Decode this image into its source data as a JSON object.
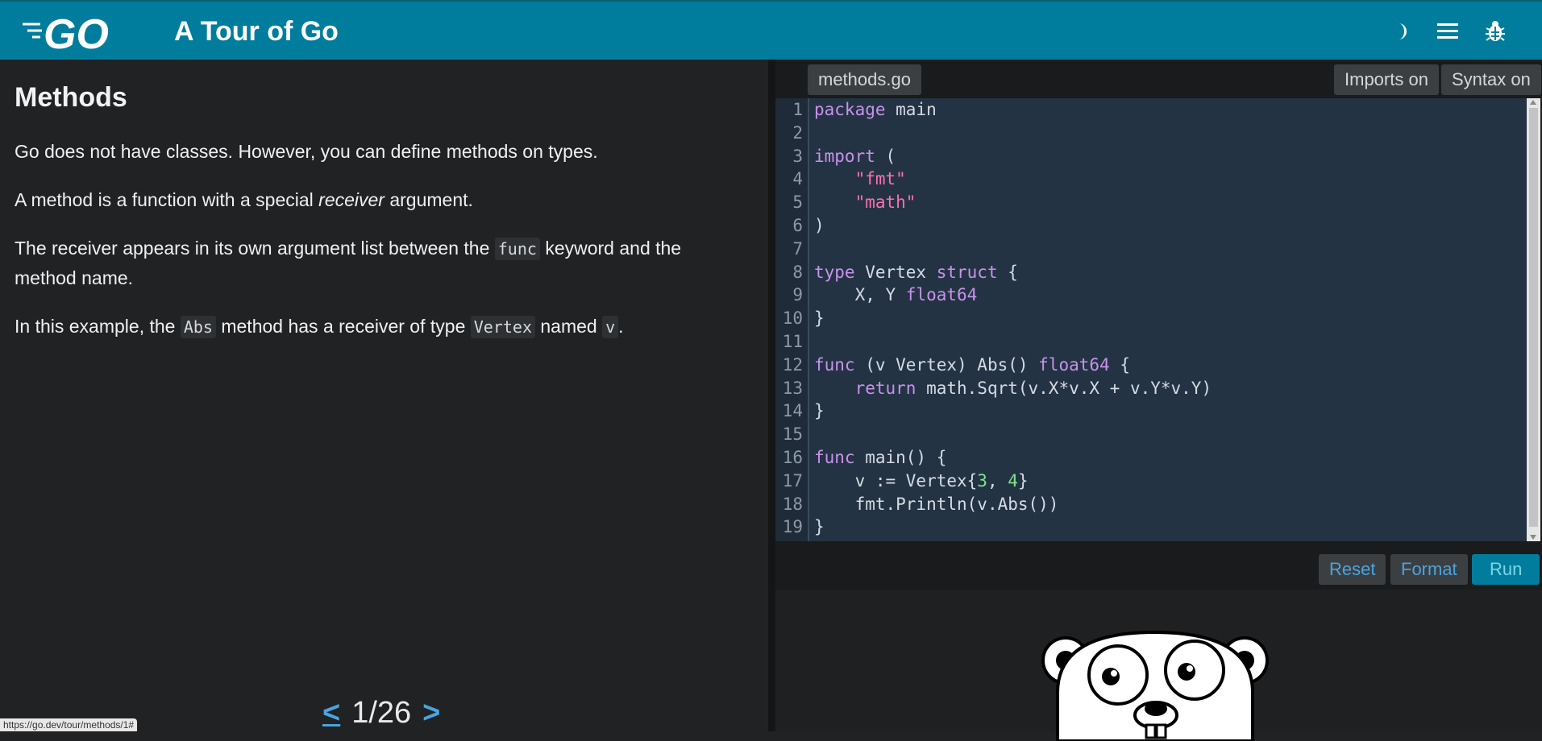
{
  "header": {
    "logo_text": "GO",
    "title": "A Tour of Go",
    "icons": [
      "moon-icon",
      "menu-icon",
      "bug-icon"
    ],
    "bg_color": "#007d9c"
  },
  "lesson": {
    "title": "Methods",
    "p1": "Go does not have classes. However, you can define methods on types.",
    "p2_before": "A method is a function with a special ",
    "p2_em": "receiver",
    "p2_after": " argument.",
    "p3_before": "The receiver appears in its own argument list between the ",
    "p3_code": "func",
    "p3_after": " keyword and the method name.",
    "p4_a": "In this example, the ",
    "p4_code1": "Abs",
    "p4_b": " method has a receiver of type ",
    "p4_code2": "Vertex",
    "p4_c": " named ",
    "p4_code3": "v",
    "p4_d": "."
  },
  "pager": {
    "prev": "<",
    "count": "1/26",
    "next": ">"
  },
  "status_url": "https://go.dev/tour/methods/1#",
  "editor": {
    "filename": "methods.go",
    "imports_label": "Imports on",
    "syntax_label": "Syntax on",
    "line_numbers": [
      "1",
      "2",
      "3",
      "4",
      "5",
      "6",
      "7",
      "8",
      "9",
      "10",
      "11",
      "12",
      "13",
      "14",
      "15",
      "16",
      "17",
      "18",
      "19"
    ],
    "code": {
      "l1_kw": "package",
      "l1_rest": " main",
      "l3_kw": "import",
      "l3_rest": " (",
      "l4": "\"fmt\"",
      "l5": "\"math\"",
      "l6": ")",
      "l8_kw1": "type",
      "l8_mid": " Vertex ",
      "l8_kw2": "struct",
      "l8_rest": " {",
      "l9_a": "X, Y ",
      "l9_kw": "float64",
      "l10": "}",
      "l12_kw1": "func",
      "l12_mid": " (v Vertex) Abs() ",
      "l12_kw2": "float64",
      "l12_rest": " {",
      "l13_kw": "return",
      "l13_rest": " math.Sqrt(v.X*v.X + v.Y*v.Y)",
      "l14": "}",
      "l16_kw": "func",
      "l16_rest": " main() {",
      "l17_a": "v := Vertex{",
      "l17_n1": "3",
      "l17_b": ", ",
      "l17_n2": "4",
      "l17_c": "}",
      "l18": "fmt.Println(v.Abs())",
      "l19": "}"
    }
  },
  "actions": {
    "reset": "Reset",
    "format": "Format",
    "run": "Run"
  }
}
